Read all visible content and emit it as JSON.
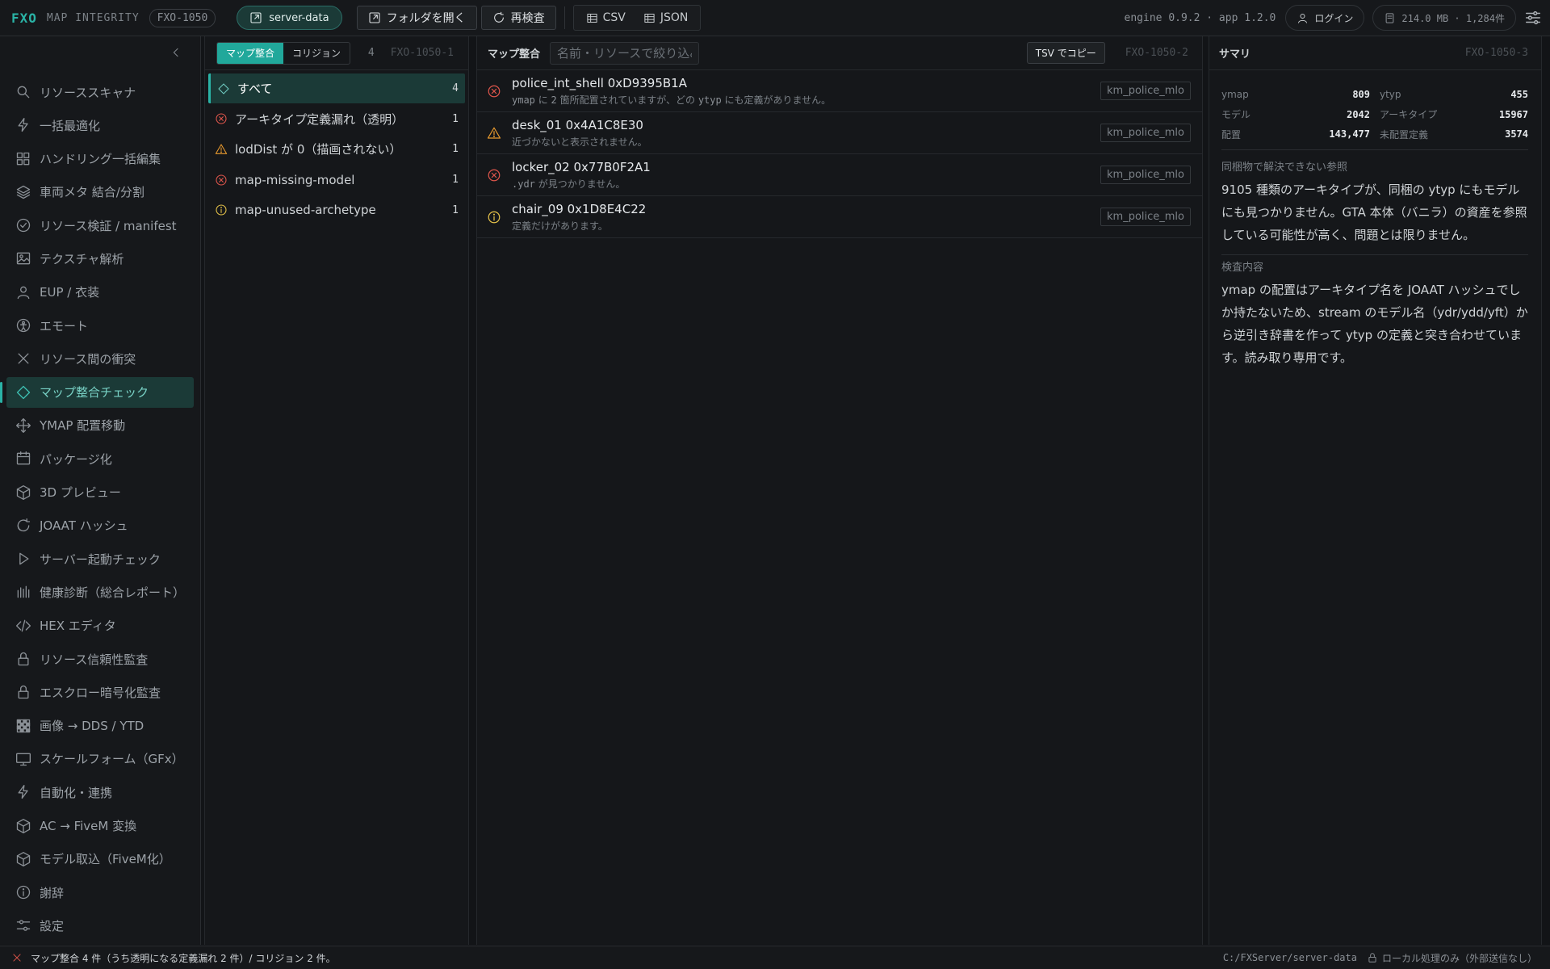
{
  "app": {
    "logo": "FXO",
    "subtitle": "MAP INTEGRITY",
    "id_badge": "FXO-1050",
    "server_label": "server-data",
    "open_folder_label": "フォルダを開く",
    "rescan_label": "再検査",
    "export_csv_label": "CSV",
    "export_json_label": "JSON",
    "version_text": "engine 0.9.2 · app 1.2.0",
    "login_label": "ログイン",
    "storage_text": "214.0 MB · 1,284件",
    "accent_color": "#2ab3a6"
  },
  "nav": {
    "items": [
      {
        "label": "リソーススキャナ",
        "icon": "search-icon"
      },
      {
        "label": "一括最適化",
        "icon": "bolt-icon"
      },
      {
        "label": "ハンドリング一括編集",
        "icon": "grid-icon"
      },
      {
        "label": "車両メタ 結合/分割",
        "icon": "layers-icon"
      },
      {
        "label": "リソース検証 / manifest",
        "icon": "check-circle-icon"
      },
      {
        "label": "テクスチャ解析",
        "icon": "image-icon"
      },
      {
        "label": "EUP / 衣装",
        "icon": "user-icon"
      },
      {
        "label": "エモート",
        "icon": "person-circle-icon"
      },
      {
        "label": "リソース間の衝突",
        "icon": "x-icon"
      },
      {
        "label": "マップ整合チェック",
        "icon": "diamond-icon",
        "active": true
      },
      {
        "label": "YMAP 配置移動",
        "icon": "move-icon"
      },
      {
        "label": "パッケージ化",
        "icon": "archive-icon"
      },
      {
        "label": "3D プレビュー",
        "icon": "cube-icon"
      },
      {
        "label": "JOAAT ハッシュ",
        "icon": "refresh-icon"
      },
      {
        "label": "サーバー起動チェック",
        "icon": "play-icon"
      },
      {
        "label": "健康診断（総合レポート）",
        "icon": "bars-icon"
      },
      {
        "label": "HEX エディタ",
        "icon": "code-icon"
      },
      {
        "label": "リソース信頼性監査",
        "icon": "lock-icon"
      },
      {
        "label": "エスクロー暗号化監査",
        "icon": "lock-icon"
      },
      {
        "label": "画像 → DDS / YTD",
        "icon": "checker-icon"
      },
      {
        "label": "スケールフォーム（GFx）",
        "icon": "monitor-icon"
      },
      {
        "label": "自動化・連携",
        "icon": "bolt-icon"
      },
      {
        "label": "AC → FiveM 変換",
        "icon": "cube-icon"
      },
      {
        "label": "モデル取込（FiveM化）",
        "icon": "cube-icon"
      },
      {
        "label": "謝辞",
        "icon": "info-icon"
      },
      {
        "label": "設定",
        "icon": "sliders-icon"
      }
    ]
  },
  "filters": {
    "tab_map": "マップ整合",
    "tab_collision": "コリジョン",
    "count": "4",
    "panel_id": "FXO-1050-1",
    "items": [
      {
        "label": "すべて",
        "count": "4",
        "icon": "diamond-icon",
        "selected": true
      },
      {
        "label": "アーキタイプ定義漏れ（透明）",
        "count": "1",
        "icon": "error-icon"
      },
      {
        "label": "lodDist が 0（描画されない）",
        "count": "1",
        "icon": "warning-icon"
      },
      {
        "label": "map-missing-model",
        "count": "1",
        "icon": "error-icon"
      },
      {
        "label": "map-unused-archetype",
        "count": "1",
        "icon": "info-icon"
      }
    ]
  },
  "issues": {
    "label": "マップ整合",
    "search_placeholder": "名前・リソースで絞り込み",
    "copy_tsv_label": "TSV でコピー",
    "panel_id": "FXO-1050-2",
    "rows": [
      {
        "severity": "error",
        "title": "police_int_shell 0xD9395B1A",
        "desc_a": "ymap",
        "desc_b": " に ",
        "desc_c": "2",
        "desc_d": " 箇所配置されていますが、どの ",
        "desc_e": "ytyp",
        "desc_f": " にも定義がありません。",
        "resource": "km_police_mlo"
      },
      {
        "severity": "warning",
        "title": "desk_01 0x4A1C8E30",
        "desc": "近づかないと表示されません。",
        "resource": "km_police_mlo"
      },
      {
        "severity": "error",
        "title": "locker_02 0x77B0F2A1",
        "desc_a": ".ydr",
        "desc_b": " が見つかりません。",
        "resource": "km_police_mlo"
      },
      {
        "severity": "info",
        "title": "chair_09 0x1D8E4C22",
        "desc": "定義だけがあります。",
        "resource": "km_police_mlo"
      }
    ]
  },
  "summary": {
    "label": "サマリ",
    "panel_id": "FXO-1050-3",
    "stats": [
      {
        "k": "ymap",
        "v": "809"
      },
      {
        "k": "ytyp",
        "v": "455"
      },
      {
        "k": "モデル",
        "v": "2042"
      },
      {
        "k": "アーキタイプ",
        "v": "15967"
      },
      {
        "k": "配置",
        "v": "143,477"
      },
      {
        "k": "未配置定義",
        "v": "3574"
      }
    ],
    "section1_title": "同梱物で解決できない参照",
    "section1_body": "9105 種類のアーキタイプが、同梱の ytyp にもモデルにも見つかりません。GTA 本体（バニラ）の資産を参照している可能性が高く、問題とは限りません。",
    "section2_title": "検査内容",
    "section2_body": "ymap の配置はアーキタイプ名を JOAAT ハッシュでしか持たないため、stream のモデル名（ydr/ydd/yft）から逆引き辞書を作って ytyp の定義と突き合わせています。読み取り専用です。"
  },
  "status": {
    "message": "マップ整合 4 件（うち透明になる定義漏れ 2 件）/ コリジョン 2 件。",
    "path": "C:/FXServer/server-data",
    "local_note": "ローカル処理のみ（外部送信なし）"
  }
}
